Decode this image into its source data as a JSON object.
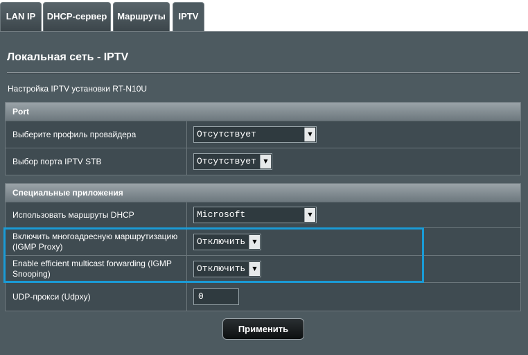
{
  "tabs": [
    {
      "label": "LAN IP"
    },
    {
      "label": "DHCP-сервер"
    },
    {
      "label": "Маршруты"
    },
    {
      "label": "IPTV"
    }
  ],
  "page": {
    "title": "Локальная сеть - IPTV",
    "subtitle": "Настройка IPTV установки RT-N10U"
  },
  "sections": {
    "port": {
      "header": "Port",
      "provider_profile": {
        "label": "Выберите профиль провайдера",
        "value": "Отсутствует"
      },
      "stb_port": {
        "label": "Выбор порта IPTV STB",
        "value": "Отсутствует"
      }
    },
    "special": {
      "header": "Специальные приложения",
      "dhcp_routes": {
        "label": "Использовать маршруты DHCP",
        "value": "Microsoft"
      },
      "igmp_proxy": {
        "label": "Включить многоадресную маршрутизацию (IGMP Proxy)",
        "value": "Отключить"
      },
      "igmp_snooping": {
        "label": "Enable efficient multicast forwarding (IGMP Snooping)",
        "value": "Отключить"
      },
      "udpxy": {
        "label": "UDP-прокси (Udpxy)",
        "value": "0"
      }
    }
  },
  "apply_label": "Применить",
  "colors": {
    "highlight": "#1a9bd6",
    "panel": "#4d5a60"
  }
}
